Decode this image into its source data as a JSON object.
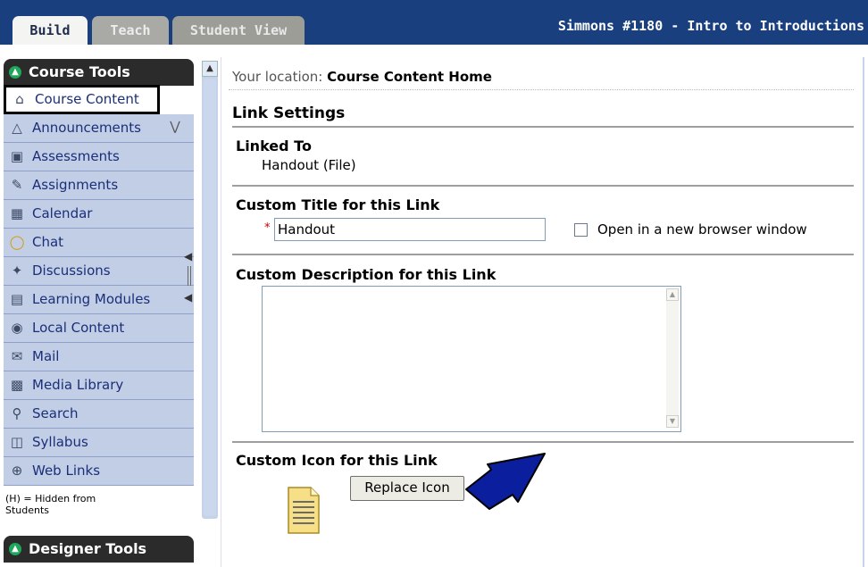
{
  "tabs": {
    "build": "Build",
    "teach": "Teach",
    "student_view": "Student View"
  },
  "course_title": "Simmons #1180 - Intro to Introductions",
  "sidebar": {
    "course_tools_title": "Course Tools",
    "designer_tools_title": "Designer Tools",
    "items": [
      {
        "label": "Course Content",
        "icon": "house-icon"
      },
      {
        "label": "Announcements",
        "icon": "megaphone-icon"
      },
      {
        "label": "Assessments",
        "icon": "assessment-icon"
      },
      {
        "label": "Assignments",
        "icon": "assignment-icon"
      },
      {
        "label": "Calendar",
        "icon": "calendar-icon"
      },
      {
        "label": "Chat",
        "icon": "chat-icon"
      },
      {
        "label": "Discussions",
        "icon": "pin-icon"
      },
      {
        "label": "Learning Modules",
        "icon": "module-icon"
      },
      {
        "label": "Local Content",
        "icon": "disc-icon"
      },
      {
        "label": "Mail",
        "icon": "mail-icon"
      },
      {
        "label": "Media Library",
        "icon": "media-icon"
      },
      {
        "label": "Search",
        "icon": "search-icon"
      },
      {
        "label": "Syllabus",
        "icon": "syllabus-icon"
      },
      {
        "label": "Web Links",
        "icon": "globe-icon"
      }
    ],
    "hidden_note": "(H) = Hidden from Students"
  },
  "main": {
    "location_label": "Your location:",
    "location_value": "Course Content Home",
    "link_settings": "Link Settings",
    "linked_to_title": "Linked To",
    "linked_to_value": "Handout (File)",
    "custom_title_heading": "Custom Title for this Link",
    "title_required_marker": "*",
    "title_value": "Handout",
    "new_window_label": "Open in a new browser window",
    "custom_desc_heading": "Custom Description for this Link",
    "description_value": "",
    "custom_icon_heading": "Custom Icon for this Link",
    "replace_icon_label": "Replace Icon"
  },
  "colors": {
    "topbar": "#1a3f7e",
    "sidebar_item": "#c2cde6",
    "arrow": "#0b1f9e"
  }
}
